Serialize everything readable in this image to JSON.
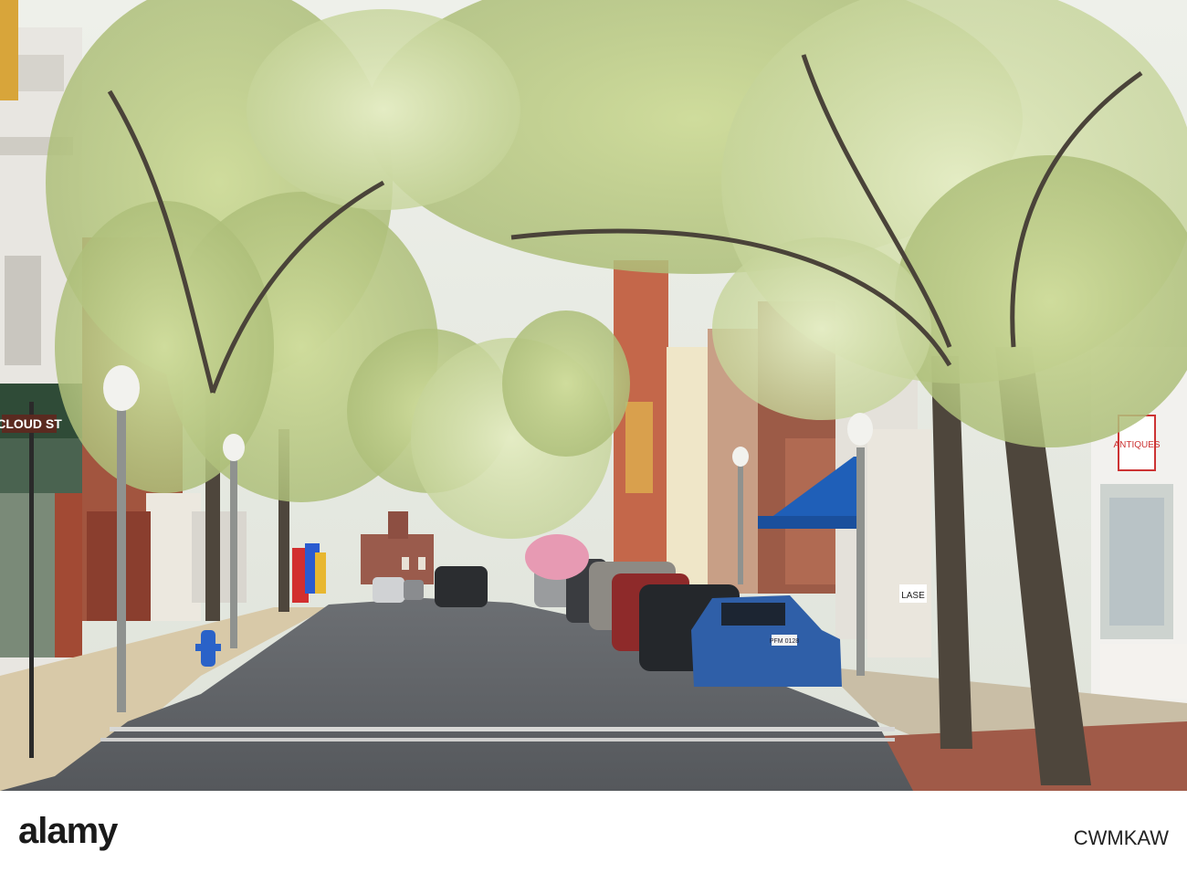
{
  "street_sign": {
    "text": "CLOUD ST"
  },
  "storefront_signs": {
    "antiques": "ANTIQUES",
    "laser": "LASE"
  },
  "license_plate": {
    "text": "PFM 0128"
  },
  "watermark": {
    "logo": "alamy",
    "image_id": "CWMKAW"
  },
  "colors": {
    "sky": "#e9ebe6",
    "foliage": "#b9c98a",
    "road": "#5d6064",
    "awning": "#1f5fb8",
    "car_blue": "#2f5fa8"
  }
}
